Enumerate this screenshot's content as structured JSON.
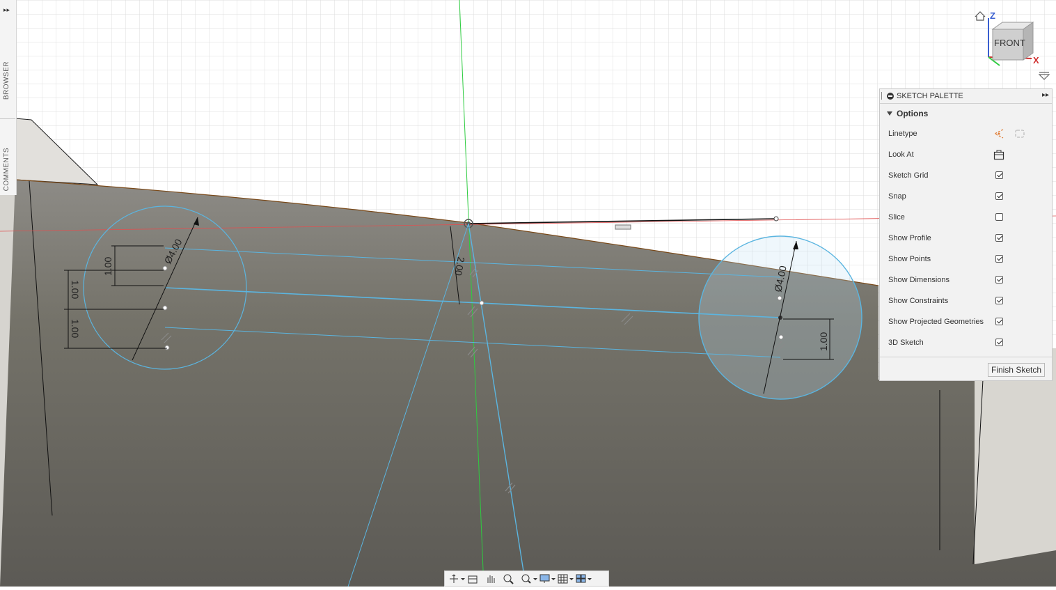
{
  "left_panel": {
    "expand_glyph": "▸▸",
    "browser_label": "BROWSER",
    "comments_label": "COMMENTS"
  },
  "viewcube": {
    "face_label": "FRONT",
    "axis_z": "Z",
    "axis_x": "X",
    "home_icon": "home-icon",
    "menu_icon": "chevron-down-icon"
  },
  "sketch_palette": {
    "title": "SKETCH PALETTE",
    "expand_glyph": "▸▸",
    "section_title": "Options",
    "linetype_label": "Linetype",
    "look_at_label": "Look At",
    "options": [
      {
        "label": "Sketch Grid",
        "checked": true
      },
      {
        "label": "Snap",
        "checked": true
      },
      {
        "label": "Slice",
        "checked": false
      },
      {
        "label": "Show Profile",
        "checked": true
      },
      {
        "label": "Show Points",
        "checked": true
      },
      {
        "label": "Show Dimensions",
        "checked": true
      },
      {
        "label": "Show Constraints",
        "checked": true
      },
      {
        "label": "Show Projected Geometries",
        "checked": true
      },
      {
        "label": "3D Sketch",
        "checked": true
      }
    ],
    "finish_button": "Finish Sketch"
  },
  "sketch": {
    "dimensions": {
      "left_diameter": "Ø4.00",
      "right_diameter": "Ø4.00",
      "left_top_offset": "1.00",
      "left_mid_offset": "1.00",
      "left_bottom_offset": "1.00",
      "center_offset": "2.00",
      "right_offset": "1.00"
    }
  },
  "navigation_bar": {
    "tools": [
      "orbit-icon",
      "look-at-icon",
      "pan-icon",
      "zoom-icon",
      "fit-icon",
      "display-settings-icon",
      "grid-settings-icon",
      "viewports-icon"
    ]
  },
  "colors": {
    "sketch_line": "#5bb5e0",
    "grid_line": "#d9d9d9",
    "body_surface": "#6f6d68",
    "y_axis": "#2ecc40",
    "x_axis": "#e05050"
  }
}
